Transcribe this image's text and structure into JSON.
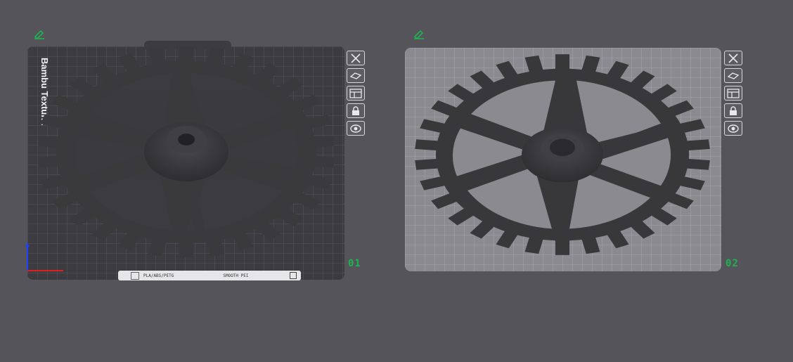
{
  "plates": [
    {
      "number": "01",
      "side_label": "Bambu Textur...",
      "status": {
        "filament": "PLA/ABS/PETG",
        "surface": "SMOOTH PEI"
      },
      "toolbar": [
        "close-icon",
        "arrange-icon",
        "layout-icon",
        "lock-icon",
        "eye-icon"
      ]
    },
    {
      "number": "02",
      "toolbar": [
        "close-icon",
        "arrange-icon",
        "layout-icon",
        "lock-icon",
        "eye-icon"
      ]
    }
  ],
  "colors": {
    "background": "#55545b",
    "plate_dark": "#3b3b40",
    "plate_light": "#8a8a90",
    "accent_green": "#1db34e",
    "gear": "#3a3a3d"
  }
}
